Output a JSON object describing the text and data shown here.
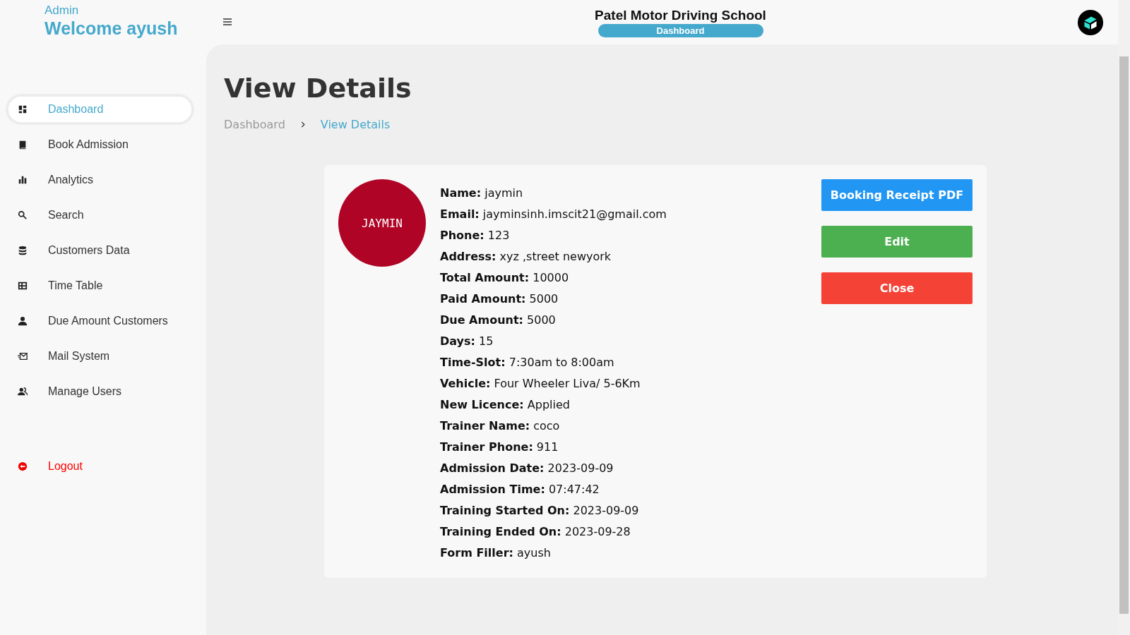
{
  "sidebar": {
    "role": "Admin",
    "welcome": "Welcome ayush",
    "items": [
      {
        "label": "Dashboard",
        "selected": true,
        "kind": "nav"
      },
      {
        "label": "Book Admission",
        "selected": false,
        "kind": "nav"
      },
      {
        "label": "Analytics",
        "selected": false,
        "kind": "nav"
      },
      {
        "label": "Search",
        "selected": false,
        "kind": "nav"
      },
      {
        "label": "Customers Data",
        "selected": false,
        "kind": "nav"
      },
      {
        "label": "Time Table",
        "selected": false,
        "kind": "nav"
      },
      {
        "label": "Due Amount Customers",
        "selected": false,
        "kind": "nav"
      },
      {
        "label": "Mail System",
        "selected": false,
        "kind": "nav"
      },
      {
        "label": "Manage Users",
        "selected": false,
        "kind": "nav"
      },
      {
        "label": "Logout",
        "selected": false,
        "kind": "logout"
      }
    ]
  },
  "header": {
    "title": "Patel Motor Driving School",
    "badge": "Dashboard"
  },
  "page": {
    "title": "View Details",
    "breadcrumb": [
      {
        "label": "Dashboard",
        "selected": false
      },
      {
        "label": "View Details",
        "selected": true
      }
    ]
  },
  "details": {
    "avatar": "JAYMIN",
    "fields": [
      {
        "label": "Name:",
        "value": "jaymin"
      },
      {
        "label": "Email:",
        "value": "jayminsinh.imscit21@gmail.com"
      },
      {
        "label": "Phone:",
        "value": "123"
      },
      {
        "label": "Address:",
        "value": "xyz ,street newyork"
      },
      {
        "label": "Total Amount:",
        "value": "10000"
      },
      {
        "label": "Paid Amount:",
        "value": "5000"
      },
      {
        "label": "Due Amount:",
        "value": "5000"
      },
      {
        "label": "Days:",
        "value": "15"
      },
      {
        "label": "Time-Slot:",
        "value": "7:30am to 8:00am"
      },
      {
        "label": "Vehicle:",
        "value": "Four Wheeler Liva/ 5-6Km"
      },
      {
        "label": "New Licence:",
        "value": "Applied"
      },
      {
        "label": "Trainer Name:",
        "value": "coco"
      },
      {
        "label": "Trainer Phone:",
        "value": "911"
      },
      {
        "label": "Admission Date:",
        "value": "2023-09-09"
      },
      {
        "label": "Admission Time:",
        "value": "07:47:42"
      },
      {
        "label": "Training Started On:",
        "value": "2023-09-09"
      },
      {
        "label": "Training Ended On:",
        "value": "2023-09-28"
      },
      {
        "label": "Form Filler:",
        "value": "ayush"
      }
    ],
    "buttons": [
      {
        "label": "Booking Receipt PDF",
        "color": "#2196f3"
      },
      {
        "label": "Edit",
        "color": "#4caf50"
      },
      {
        "label": "Close",
        "color": "#f44336"
      }
    ]
  }
}
